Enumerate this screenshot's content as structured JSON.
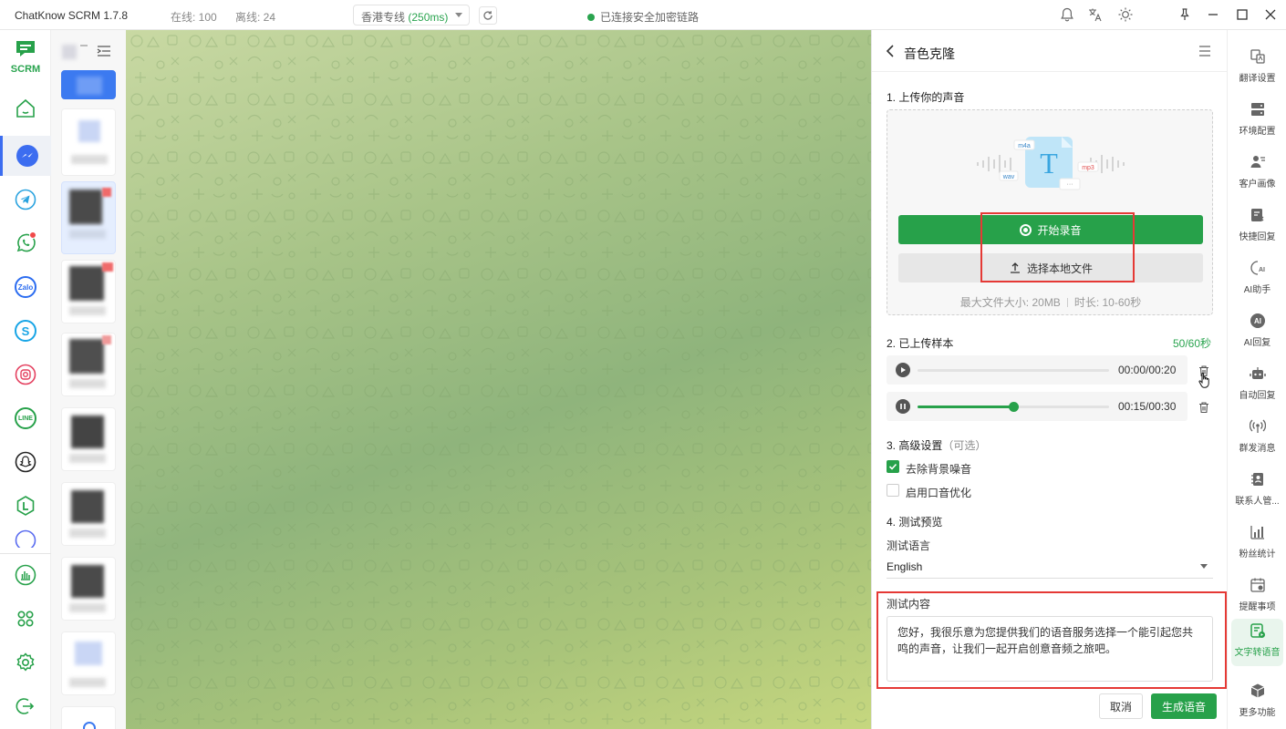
{
  "titlebar": {
    "app_title": "ChatKnow SCRM 1.7.8",
    "online": "在线: 100",
    "offline": "离线: 24",
    "route_name": "香港专线 ",
    "route_latency": "(250ms)",
    "connection_status": "已连接安全加密链路"
  },
  "leftnav": {
    "logo_text": "SCRM",
    "items": [
      "home",
      "messenger",
      "telegram",
      "whatsapp",
      "zalo",
      "skype",
      "instagram",
      "line",
      "snapchat",
      "line-works",
      "messenger-alt",
      "statistics",
      "apps",
      "settings",
      "logout"
    ]
  },
  "panel": {
    "title": "音色克隆",
    "section1": "1. 上传你的声音",
    "illustration_tags": [
      "m4a",
      "wav",
      "mp3",
      "T",
      "···"
    ],
    "record_button": "开始录音",
    "local_file_button": "选择本地文件",
    "max_size": "最大文件大小: 20MB",
    "duration": "时长: 10-60秒",
    "section2": "2. 已上传样本",
    "counter": "50/60秒",
    "samples": [
      {
        "time": "00:00/00:20",
        "state": "paused",
        "progress": 0
      },
      {
        "time": "00:15/00:30",
        "state": "playing",
        "progress": 0.5
      }
    ],
    "section3": "3. 高级设置",
    "section3_optional": "（可选）",
    "option_denoise": "去除背景噪音",
    "option_denoise_checked": true,
    "option_accent": "启用口音优化",
    "option_accent_checked": false,
    "section4": "4. 测试预览",
    "test_language_label": "测试语言",
    "test_language_value": "English",
    "test_content_label": "测试内容",
    "test_content": "您好，我很乐意为您提供我们的语音服务选择一个能引起您共鸣的声音，让我们一起开启创意音频之旅吧。",
    "cancel_button": "取消",
    "generate_button": "生成语音"
  },
  "rightbar": {
    "items": [
      {
        "label": "翻译设置",
        "icon": "translate-icon"
      },
      {
        "label": "环境配置",
        "icon": "server-icon"
      },
      {
        "label": "客户画像",
        "icon": "user-profile-icon"
      },
      {
        "label": "快捷回复",
        "icon": "quick-reply-icon"
      },
      {
        "label": "AI助手",
        "icon": "ai-assistant-icon"
      },
      {
        "label": "AI回复",
        "icon": "ai-reply-icon"
      },
      {
        "label": "自动回复",
        "icon": "robot-icon"
      },
      {
        "label": "群发消息",
        "icon": "broadcast-icon"
      },
      {
        "label": "联系人管...",
        "icon": "contacts-icon"
      },
      {
        "label": "粉丝统计",
        "icon": "chart-icon"
      },
      {
        "label": "提醒事项",
        "icon": "calendar-icon"
      },
      {
        "label": "文字转语音",
        "icon": "tts-icon",
        "active": true
      },
      {
        "label": "更多功能",
        "icon": "box-icon"
      }
    ]
  },
  "colors": {
    "accent": "#27a14a",
    "highlight_box": "#e53935",
    "nav_active": "#3c6df0"
  }
}
